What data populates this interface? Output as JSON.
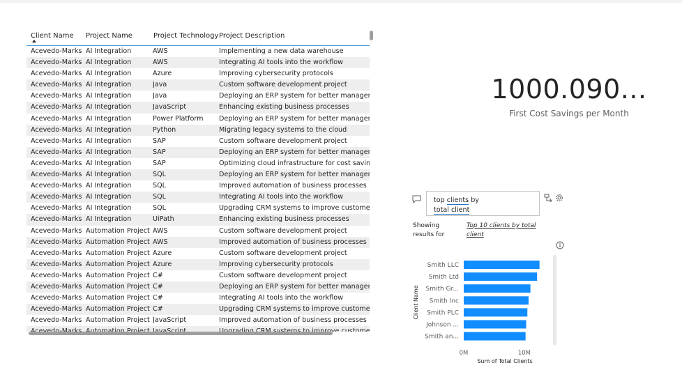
{
  "table": {
    "headers": [
      "Client Name",
      "Project Name",
      "Project Technology",
      "Project Description"
    ],
    "rows": [
      [
        "Acevedo-Marks",
        "AI Integration",
        "AWS",
        "Implementing a new data warehouse"
      ],
      [
        "Acevedo-Marks",
        "AI Integration",
        "AWS",
        "Integrating AI tools into the workflow"
      ],
      [
        "Acevedo-Marks",
        "AI Integration",
        "Azure",
        "Improving cybersecurity protocols"
      ],
      [
        "Acevedo-Marks",
        "AI Integration",
        "Java",
        "Custom software development project"
      ],
      [
        "Acevedo-Marks",
        "AI Integration",
        "Java",
        "Deploying an ERP system for better management"
      ],
      [
        "Acevedo-Marks",
        "AI Integration",
        "JavaScript",
        "Enhancing existing business processes"
      ],
      [
        "Acevedo-Marks",
        "AI Integration",
        "Power Platform",
        "Deploying an ERP system for better management"
      ],
      [
        "Acevedo-Marks",
        "AI Integration",
        "Python",
        "Migrating legacy systems to the cloud"
      ],
      [
        "Acevedo-Marks",
        "AI Integration",
        "SAP",
        "Custom software development project"
      ],
      [
        "Acevedo-Marks",
        "AI Integration",
        "SAP",
        "Deploying an ERP system for better management"
      ],
      [
        "Acevedo-Marks",
        "AI Integration",
        "SAP",
        "Optimizing cloud infrastructure for cost savings"
      ],
      [
        "Acevedo-Marks",
        "AI Integration",
        "SQL",
        "Deploying an ERP system for better management"
      ],
      [
        "Acevedo-Marks",
        "AI Integration",
        "SQL",
        "Improved automation of business processes"
      ],
      [
        "Acevedo-Marks",
        "AI Integration",
        "SQL",
        "Integrating AI tools into the workflow"
      ],
      [
        "Acevedo-Marks",
        "AI Integration",
        "SQL",
        "Upgrading CRM systems to improve customer management"
      ],
      [
        "Acevedo-Marks",
        "AI Integration",
        "UiPath",
        "Enhancing existing business processes"
      ],
      [
        "Acevedo-Marks",
        "Automation Project",
        "AWS",
        "Custom software development project"
      ],
      [
        "Acevedo-Marks",
        "Automation Project",
        "AWS",
        "Improved automation of business processes"
      ],
      [
        "Acevedo-Marks",
        "Automation Project",
        "Azure",
        "Custom software development project"
      ],
      [
        "Acevedo-Marks",
        "Automation Project",
        "Azure",
        "Improving cybersecurity protocols"
      ],
      [
        "Acevedo-Marks",
        "Automation Project",
        "C#",
        "Custom software development project"
      ],
      [
        "Acevedo-Marks",
        "Automation Project",
        "C#",
        "Deploying an ERP system for better management"
      ],
      [
        "Acevedo-Marks",
        "Automation Project",
        "C#",
        "Integrating AI tools into the workflow"
      ],
      [
        "Acevedo-Marks",
        "Automation Project",
        "C#",
        "Upgrading CRM systems to improve customer management"
      ],
      [
        "Acevedo-Marks",
        "Automation Project",
        "JavaScript",
        "Improved automation of business processes"
      ],
      [
        "Acevedo-Marks",
        "Automation Project",
        "JavaScript",
        "Upgrading CRM systems to improve customer management"
      ]
    ]
  },
  "card": {
    "value": "1000.090...",
    "label": "First Cost Savings per Month"
  },
  "qa": {
    "query_part1": "top ",
    "query_word1": "clients",
    "query_part2": " by",
    "query_word2": "total client",
    "showing_label": "Showing results for",
    "result_link": "Top 10 clients by total client"
  },
  "chart_data": {
    "type": "bar",
    "orientation": "horizontal",
    "categories": [
      "Smith LLC",
      "Smith Ltd",
      "Smith Gr...",
      "Smith Inc",
      "Smith PLC",
      "Johnson ...",
      "Smith an..."
    ],
    "values": [
      12500000,
      12100000,
      11000000,
      10700000,
      10500000,
      10300000,
      10200000
    ],
    "xlabel": "Sum of Total Clients",
    "ylabel": "Client Name",
    "xticks": [
      "0M",
      "10M"
    ],
    "xlim": [
      0,
      13000000
    ],
    "bar_color": "#118dff"
  },
  "colors": {
    "accent": "#118dff",
    "header_underline": "#4a9ad6",
    "alt_row": "#eeeeee"
  },
  "icons": [
    "sort-ascending-icon",
    "qa-speech-bubble-icon",
    "convert-to-visual-icon",
    "settings-gear-icon",
    "info-icon"
  ]
}
